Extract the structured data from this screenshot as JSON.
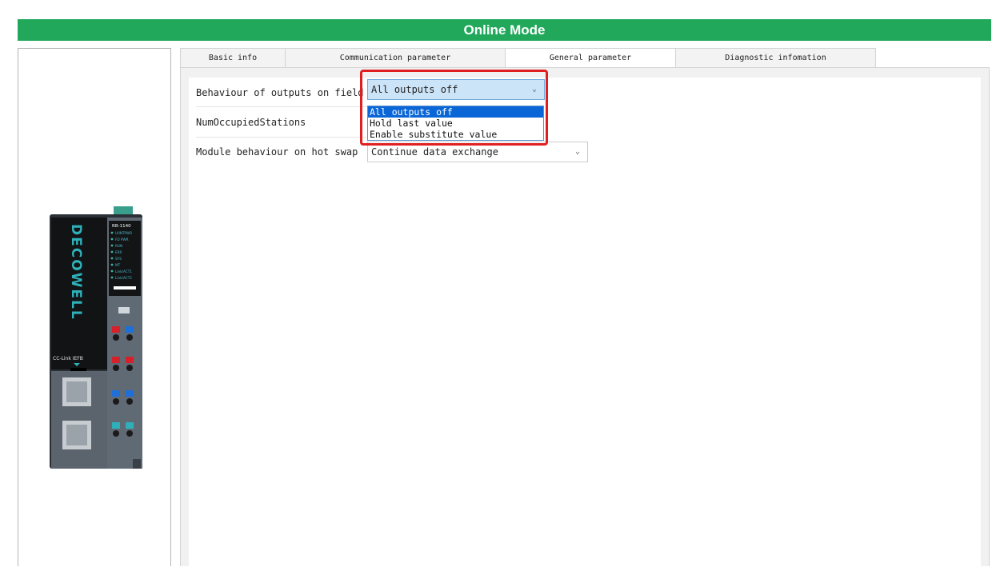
{
  "window": {
    "title": "Online Mode"
  },
  "tabs": [
    {
      "label": "Basic info",
      "active": false
    },
    {
      "label": "Communication parameter",
      "active": false
    },
    {
      "label": "General parameter",
      "active": true
    },
    {
      "label": "Diagnostic infomation",
      "active": false
    }
  ],
  "params": [
    {
      "label": "Behaviour of outputs on field",
      "value": "All outputs off",
      "open": true
    },
    {
      "label": "NumOccupiedStations"
    },
    {
      "label": "Module behaviour on hot swap",
      "value": "Continue data exchange"
    }
  ],
  "dropdown_options": [
    {
      "label": "All outputs off",
      "selected": true
    },
    {
      "label": "Hold last value",
      "selected": false
    },
    {
      "label": "Enable substitute value",
      "selected": false
    }
  ],
  "device": {
    "brand": "DECOWELL",
    "model": "RB-1140",
    "leds": [
      "U/INTPWR",
      "FD PWR",
      "RUN",
      "ERR",
      "SYS",
      "MT",
      "Link/ACT1",
      "Link/ACT2"
    ],
    "bus_label": "CC-Link IEFB"
  },
  "colors": {
    "title_bar": "#21a85b",
    "highlight": "#e02020",
    "selection": "#0a66d6"
  },
  "icons": {
    "combo_arrow": "chevron-down-icon"
  }
}
